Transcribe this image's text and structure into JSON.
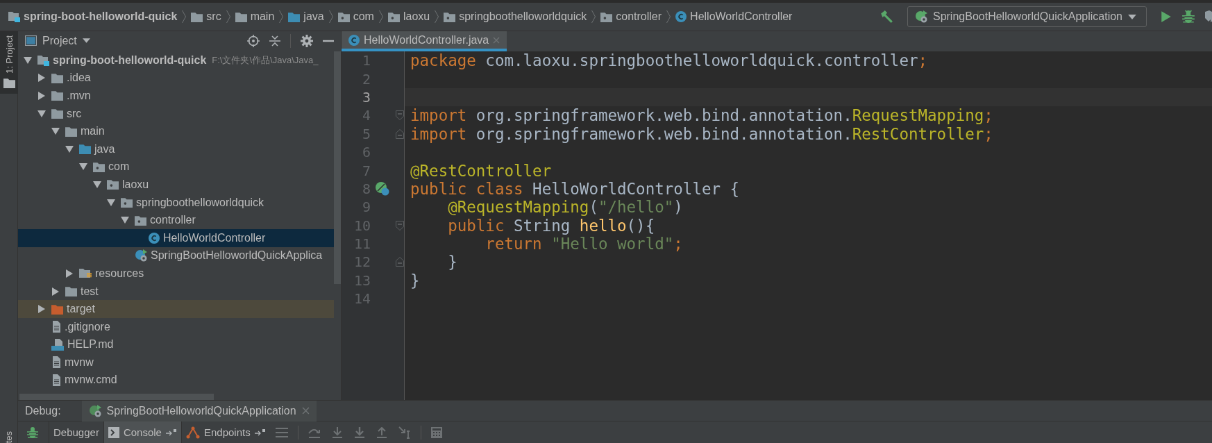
{
  "breadcrumbs": [
    {
      "label": "spring-boot-helloworld-quick",
      "kind": "module"
    },
    {
      "label": "src",
      "kind": "folder"
    },
    {
      "label": "main",
      "kind": "folder"
    },
    {
      "label": "java",
      "kind": "source-folder"
    },
    {
      "label": "com",
      "kind": "package"
    },
    {
      "label": "laoxu",
      "kind": "package"
    },
    {
      "label": "springboothelloworldquick",
      "kind": "package"
    },
    {
      "label": "controller",
      "kind": "package"
    },
    {
      "label": "HelloWorldController",
      "kind": "class"
    }
  ],
  "run_config": {
    "label": "SpringBootHelloworldQuickApplication"
  },
  "tool_strip": {
    "items": [
      {
        "label": "1: Project",
        "selected": true
      }
    ],
    "bottom_label": "tes"
  },
  "project_panel": {
    "title": "Project",
    "tree": [
      {
        "label": "spring-boot-helloworld-quick",
        "path": "F:\\文件夹\\作品\\Java\\Java_",
        "kind": "module",
        "expanded": true,
        "selected": false,
        "highlighted": false,
        "children": [
          {
            "label": ".idea",
            "kind": "folder",
            "expanded": false,
            "selected": false,
            "highlighted": false
          },
          {
            "label": ".mvn",
            "kind": "folder",
            "expanded": false,
            "selected": false,
            "highlighted": false
          },
          {
            "label": "src",
            "kind": "folder",
            "expanded": true,
            "selected": false,
            "highlighted": false,
            "children": [
              {
                "label": "main",
                "kind": "folder",
                "expanded": true,
                "selected": false,
                "highlighted": false,
                "children": [
                  {
                    "label": "java",
                    "kind": "source-folder",
                    "expanded": true,
                    "selected": false,
                    "highlighted": false,
                    "children": [
                      {
                        "label": "com",
                        "kind": "package",
                        "expanded": true,
                        "selected": false,
                        "highlighted": false,
                        "children": [
                          {
                            "label": "laoxu",
                            "kind": "package",
                            "expanded": true,
                            "selected": false,
                            "highlighted": false,
                            "children": [
                              {
                                "label": "springboothelloworldquick",
                                "kind": "package",
                                "expanded": true,
                                "selected": false,
                                "highlighted": false,
                                "children": [
                                  {
                                    "label": "controller",
                                    "kind": "package",
                                    "expanded": true,
                                    "selected": false,
                                    "highlighted": false,
                                    "children": [
                                      {
                                        "label": "HelloWorldController",
                                        "kind": "class",
                                        "selected": true,
                                        "highlighted": false
                                      }
                                    ]
                                  },
                                  {
                                    "label": "SpringBootHelloworldQuickApplica",
                                    "kind": "spring-app",
                                    "selected": false,
                                    "highlighted": false
                                  }
                                ]
                              }
                            ]
                          }
                        ]
                      }
                    ]
                  },
                  {
                    "label": "resources",
                    "kind": "resources",
                    "expanded": false,
                    "selected": false,
                    "highlighted": false
                  }
                ]
              },
              {
                "label": "test",
                "kind": "folder",
                "expanded": false,
                "selected": false,
                "highlighted": false
              }
            ]
          },
          {
            "label": "target",
            "kind": "excluded-folder",
            "expanded": false,
            "selected": false,
            "highlighted": true
          },
          {
            "label": ".gitignore",
            "kind": "file",
            "selected": false,
            "highlighted": false
          },
          {
            "label": "HELP.md",
            "kind": "markdown",
            "selected": false,
            "highlighted": false
          },
          {
            "label": "mvnw",
            "kind": "file",
            "selected": false,
            "highlighted": false
          },
          {
            "label": "mvnw.cmd",
            "kind": "file",
            "selected": false,
            "highlighted": false
          }
        ]
      }
    ]
  },
  "editor": {
    "tabs": [
      {
        "label": "HelloWorldController.java",
        "selected": true
      }
    ],
    "lines": [
      {
        "number": "1",
        "current": false,
        "kind": "plain",
        "tokens": [
          {
            "text": "package",
            "kind": "keyword"
          },
          {
            "text": " com.laoxu.springboothelloworldquick.controller",
            "kind": "plain"
          },
          {
            "text": ";",
            "kind": "keyword"
          }
        ]
      },
      {
        "number": "2",
        "current": false,
        "kind": "plain"
      },
      {
        "number": "3",
        "current": true,
        "kind": "plain"
      },
      {
        "number": "4",
        "current": false,
        "kind": "fold-start",
        "tokens": [
          {
            "text": "import",
            "kind": "keyword"
          },
          {
            "text": " org.springframework.web.bind.annotation.",
            "kind": "plain"
          },
          {
            "text": "RequestMapping",
            "kind": "annotation"
          },
          {
            "text": ";",
            "kind": "keyword"
          }
        ]
      },
      {
        "number": "5",
        "current": false,
        "kind": "fold-end",
        "tokens": [
          {
            "text": "import",
            "kind": "keyword"
          },
          {
            "text": " org.springframework.web.bind.annotation.",
            "kind": "plain"
          },
          {
            "text": "RestController",
            "kind": "annotation"
          },
          {
            "text": ";",
            "kind": "keyword"
          }
        ]
      },
      {
        "number": "6",
        "current": false,
        "kind": "plain"
      },
      {
        "number": "7",
        "current": false,
        "kind": "plain",
        "tokens": [
          {
            "text": "@RestController",
            "kind": "annotation"
          }
        ]
      },
      {
        "number": "8",
        "current": false,
        "kind": "bean",
        "tokens": [
          {
            "text": "public class",
            "kind": "keyword"
          },
          {
            "text": " HelloWorldController {",
            "kind": "plain"
          }
        ]
      },
      {
        "number": "9",
        "current": false,
        "kind": "plain",
        "tokens": [
          {
            "text": "    @RequestMapping",
            "kind": "annotation"
          },
          {
            "text": "(",
            "kind": "plain"
          },
          {
            "text": "\"/hello\"",
            "kind": "string"
          },
          {
            "text": ")",
            "kind": "plain"
          }
        ]
      },
      {
        "number": "10",
        "current": false,
        "kind": "fold-start",
        "tokens": [
          {
            "text": "    public",
            "kind": "keyword"
          },
          {
            "text": " String ",
            "kind": "plain"
          },
          {
            "text": "hello",
            "kind": "method"
          },
          {
            "text": "(){",
            "kind": "plain"
          }
        ]
      },
      {
        "number": "11",
        "current": false,
        "kind": "plain",
        "tokens": [
          {
            "text": "        return ",
            "kind": "keyword"
          },
          {
            "text": "\"Hello world\"",
            "kind": "string"
          },
          {
            "text": ";",
            "kind": "keyword"
          }
        ]
      },
      {
        "number": "12",
        "current": false,
        "kind": "fold-end",
        "tokens": [
          {
            "text": "    }",
            "kind": "plain"
          }
        ]
      },
      {
        "number": "13",
        "current": false,
        "kind": "plain",
        "tokens": [
          {
            "text": "}",
            "kind": "plain"
          }
        ]
      },
      {
        "number": "14",
        "current": false,
        "kind": "plain"
      }
    ]
  },
  "debug": {
    "label": "Debug:",
    "sessions": [
      {
        "label": "SpringBootHelloworldQuickApplication",
        "selected": true
      }
    ],
    "tabs": [
      {
        "label": "Debugger",
        "kind": "debugger",
        "selected": false
      },
      {
        "label": "Console",
        "kind": "console",
        "selected": true
      },
      {
        "label": "Endpoints",
        "kind": "endpoints",
        "selected": false
      }
    ]
  }
}
